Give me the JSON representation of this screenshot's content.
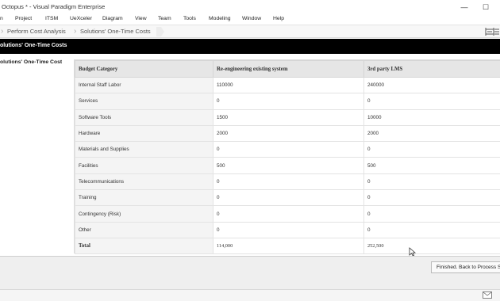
{
  "window": {
    "title": "Octopus * - Visual Paradigm Enterprise",
    "minimize_glyph": "—",
    "maximize_glyph": "☐"
  },
  "menu": {
    "items": [
      "n",
      "Project",
      "ITSM",
      "UeXceler",
      "Diagram",
      "View",
      "Team",
      "Tools",
      "Modeling",
      "Window",
      "Help"
    ]
  },
  "breadcrumb": {
    "items": [
      "Perform Cost Analysis",
      "Solutions' One-Time Costs"
    ]
  },
  "section": {
    "title": "olutions' One-Time Costs"
  },
  "left_panel": {
    "label": "olutions' One-Time Cost"
  },
  "table": {
    "headers": [
      "Budget Category",
      "Re-engineering existing system",
      "3rd party LMS"
    ],
    "rows": [
      [
        "Internal Staff Labor",
        "110000",
        "240000"
      ],
      [
        "Services",
        "0",
        "0"
      ],
      [
        "Software Tools",
        "1500",
        "10000"
      ],
      [
        "Hardware",
        "2000",
        "2000"
      ],
      [
        "Materials and Supplies",
        "0",
        "0"
      ],
      [
        "Facilities",
        "500",
        "500"
      ],
      [
        "Telecommunications",
        "0",
        "0"
      ],
      [
        "Training",
        "0",
        "0"
      ],
      [
        "Contingency (Risk)",
        "0",
        "0"
      ],
      [
        "Other",
        "0",
        "0"
      ]
    ],
    "total": [
      "Total",
      "114,000",
      "252,500"
    ]
  },
  "footer": {
    "finish_button_label": "Finished. Back to Process Steps"
  },
  "icons": {
    "breadcrumb_actions": [
      "fit-width-icon",
      "menu-icon"
    ],
    "status": "mail-icon"
  },
  "colors": {
    "header_bar": "#000000",
    "table_header": "#e6e6e6"
  }
}
